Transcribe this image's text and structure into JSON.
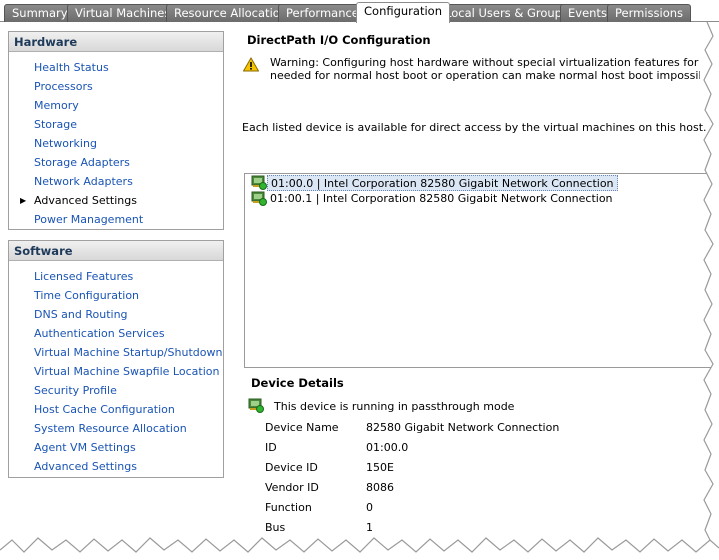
{
  "tabs": [
    {
      "label": "Summary",
      "active": false
    },
    {
      "label": "Virtual Machines",
      "active": false
    },
    {
      "label": "Resource Allocation",
      "active": false
    },
    {
      "label": "Performance",
      "active": false
    },
    {
      "label": "Configuration",
      "active": true
    },
    {
      "label": "Local Users & Groups",
      "active": false
    },
    {
      "label": "Events",
      "active": false
    },
    {
      "label": "Permissions",
      "active": false
    }
  ],
  "hardware": {
    "title": "Hardware",
    "items": [
      {
        "label": "Health Status"
      },
      {
        "label": "Processors"
      },
      {
        "label": "Memory"
      },
      {
        "label": "Storage"
      },
      {
        "label": "Networking"
      },
      {
        "label": "Storage Adapters"
      },
      {
        "label": "Network Adapters"
      },
      {
        "label": "Advanced Settings",
        "selected": true
      },
      {
        "label": "Power Management"
      }
    ]
  },
  "software": {
    "title": "Software",
    "items": [
      {
        "label": "Licensed Features"
      },
      {
        "label": "Time Configuration"
      },
      {
        "label": "DNS and Routing"
      },
      {
        "label": "Authentication Services"
      },
      {
        "label": "Virtual Machine Startup/Shutdown"
      },
      {
        "label": "Virtual Machine Swapfile Location"
      },
      {
        "label": "Security Profile"
      },
      {
        "label": "Host Cache Configuration"
      },
      {
        "label": "System Resource Allocation"
      },
      {
        "label": "Agent VM Settings"
      },
      {
        "label": "Advanced Settings"
      }
    ]
  },
  "main": {
    "title": "DirectPath I/O Configuration",
    "warning_line1": "Warning: Configuring host hardware without special virtualization features for virtual machines",
    "warning_line2": "needed for normal host boot or operation can make normal host boot impossible and may require",
    "info": "Each listed device is available for direct access by the virtual machines on this host.",
    "devices": [
      {
        "label": "01:00.0 | Intel Corporation 82580 Gigabit Network Connection",
        "selected": true
      },
      {
        "label": "01:00.1 | Intel Corporation 82580 Gigabit Network Connection",
        "selected": false
      }
    ]
  },
  "details": {
    "title": "Device Details",
    "status": "This device is running in passthrough mode",
    "props": [
      {
        "label": "Device Name",
        "value": "82580 Gigabit Network Connection"
      },
      {
        "label": "ID",
        "value": "01:00.0"
      },
      {
        "label": "Device ID",
        "value": "150E"
      },
      {
        "label": "Vendor ID",
        "value": "8086"
      },
      {
        "label": "Function",
        "value": "0"
      },
      {
        "label": "Bus",
        "value": "1"
      }
    ]
  },
  "colors": {
    "link": "#1a54b4",
    "tab_inactive": "#7a7a7a",
    "header_text": "#1e3a5a",
    "selection": "#dbe7f5"
  },
  "icons": {
    "warning": "warning-triangle-icon",
    "device": "pci-device-passthrough-icon",
    "bullet": "triangle-right-icon"
  }
}
